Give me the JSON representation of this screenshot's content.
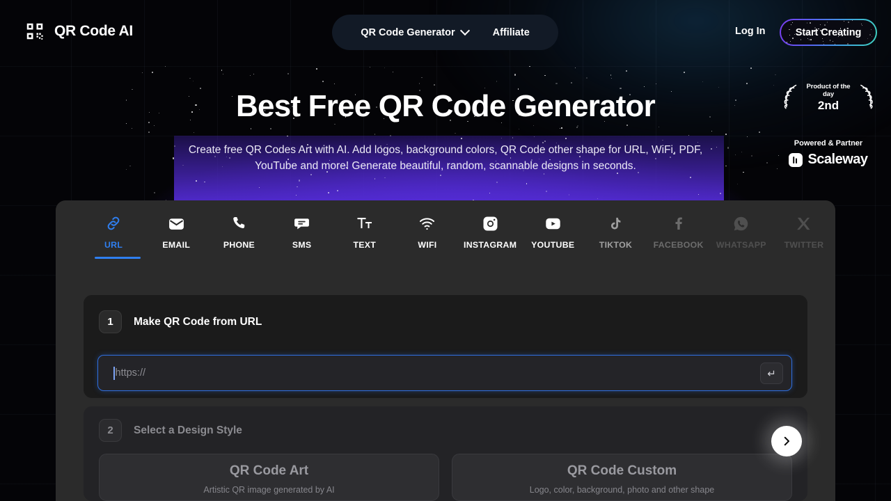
{
  "header": {
    "logo_text": "QR Code AI",
    "logo_icon": "qr-code-icon",
    "nav": [
      {
        "label": "QR Code Generator",
        "has_chevron": true,
        "icon": "chevron-down-icon"
      },
      {
        "label": "Affiliate",
        "has_chevron": false
      }
    ],
    "login_label": "Log In",
    "cta_label": "Start Creating"
  },
  "hero": {
    "title": "Best Free QR Code Generator",
    "subtitle": "Create free QR Codes Art with AI. Add logos, background colors, QR Code other shape for URL, WiFi, PDF, YouTube and more! Generate beautiful, random, scannable designs in seconds."
  },
  "badges": {
    "product_of_the_day": "Product of the day",
    "rank": "2nd",
    "powered_label": "Powered & Partner",
    "partner_name": "Scaleway"
  },
  "tabs": {
    "items": [
      {
        "label": "URL",
        "icon": "link-icon",
        "active": true
      },
      {
        "label": "EMAIL",
        "icon": "envelope-icon",
        "active": false
      },
      {
        "label": "PHONE",
        "icon": "phone-icon",
        "active": false
      },
      {
        "label": "SMS",
        "icon": "message-icon",
        "active": false
      },
      {
        "label": "TEXT",
        "icon": "text-size-icon",
        "active": false
      },
      {
        "label": "WIFI",
        "icon": "wifi-icon",
        "active": false
      },
      {
        "label": "INSTAGRAM",
        "icon": "instagram-icon",
        "active": false
      },
      {
        "label": "YOUTUBE",
        "icon": "youtube-icon",
        "active": false
      },
      {
        "label": "TIKTOK",
        "icon": "tiktok-icon",
        "active": false
      },
      {
        "label": "FACEBOOK",
        "icon": "facebook-icon",
        "active": false
      },
      {
        "label": "WHATSAPP",
        "icon": "whatsapp-icon",
        "active": false
      },
      {
        "label": "TWITTER",
        "icon": "twitter-icon",
        "active": false
      }
    ],
    "next_arrow_icon": "chevron-right-icon"
  },
  "step1": {
    "number": "1",
    "title": "Make QR Code from URL",
    "input_value": "",
    "input_placeholder": "https://",
    "submit_icon": "enter-key-icon",
    "submit_glyph": "↵"
  },
  "step2": {
    "number": "2",
    "title": "Select a Design Style",
    "styles": [
      {
        "title": "QR Code Art",
        "subtitle": "Artistic QR image generated by AI"
      },
      {
        "title": "QR Code Custom",
        "subtitle": "Logo, color, background, photo and other shape"
      }
    ]
  },
  "colors": {
    "accent_blue": "#2f7ff0",
    "panel_bg": "#2b2b2b",
    "card_bg": "#1b1b1b",
    "page_bg": "#040407",
    "hero_glow": "#5430d8"
  }
}
